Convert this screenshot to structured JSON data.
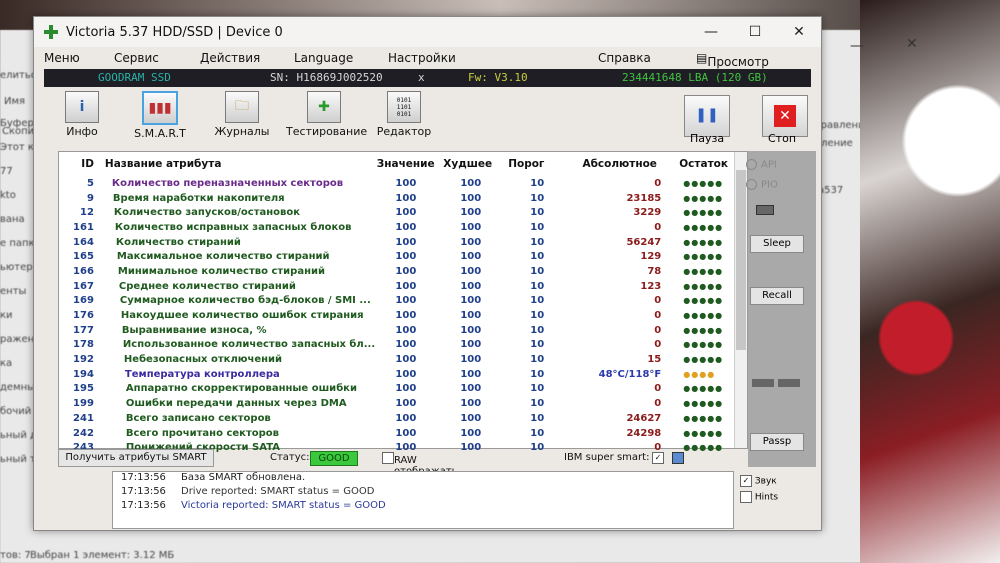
{
  "background_explorer": {
    "side_labels": [
      "елиться",
      "",
      "Буфер обм",
      "Этот компь",
      "77",
      "kto",
      "вана",
      "е папки",
      "ьютер",
      "енты",
      "ки",
      "ражения",
      "ка",
      "демные об",
      "бочий стол",
      "ьный дис",
      "ьный том (D:)"
    ],
    "header_col": "Имя",
    "right_labels": [
      "Управление",
      "деление",
      "а537"
    ],
    "status": "Выбран 1 элемент: 3.12 МБ",
    "left_status": "тов: 7",
    "top_left": "Скопировать В"
  },
  "window": {
    "title": "Victoria 5.37 HDD/SSD | Device 0",
    "menu": [
      "Меню",
      "Сервис",
      "Действия",
      "Language",
      "Настройки",
      "Справка",
      "Просмотр буфера"
    ],
    "info": {
      "model": "GOODRAM SSD",
      "serial": "SN: H16869J002520",
      "close": "x",
      "firmware": "Fw: V3.10",
      "lba": "234441648 LBA (120 GB)"
    },
    "toolbar": [
      {
        "label": "Инфо",
        "icon": "info-icon"
      },
      {
        "label": "S.M.A.R.T",
        "icon": "smart-chart-icon"
      },
      {
        "label": "Журналы",
        "icon": "journals-icon"
      },
      {
        "label": "Тестирование",
        "icon": "test-plus-icon"
      },
      {
        "label": "Редактор",
        "icon": "hex-editor-icon"
      }
    ],
    "pause_label": "Пауза",
    "stop_label": "Стоп",
    "table_headers": [
      "ID",
      "Название атрибута",
      "Значение",
      "Худшее",
      "Порог",
      "Абсолютное",
      "Остаток"
    ],
    "rows": [
      {
        "id": "5",
        "name": "Количество переназначенных секторов",
        "val": "100",
        "worst": "100",
        "thr": "10",
        "abs": "0",
        "dots": "●●●●●",
        "nc": "#6a2a8a"
      },
      {
        "id": "9",
        "name": "Время наработки накопителя",
        "val": "100",
        "worst": "100",
        "thr": "10",
        "abs": "23185",
        "dots": "●●●●●",
        "nc": "#1f5a1f"
      },
      {
        "id": "12",
        "name": "Количество запусков/остановок",
        "val": "100",
        "worst": "100",
        "thr": "10",
        "abs": "3229",
        "dots": "●●●●●",
        "nc": "#1f5a1f"
      },
      {
        "id": "161",
        "name": "Количество исправных запасных блоков",
        "val": "100",
        "worst": "100",
        "thr": "10",
        "abs": "0",
        "dots": "●●●●●",
        "nc": "#1f5a1f"
      },
      {
        "id": "164",
        "name": "Количество стираний",
        "val": "100",
        "worst": "100",
        "thr": "10",
        "abs": "56247",
        "dots": "●●●●●",
        "nc": "#1f5a1f"
      },
      {
        "id": "165",
        "name": "Максимальное количество стираний",
        "val": "100",
        "worst": "100",
        "thr": "10",
        "abs": "129",
        "dots": "●●●●●",
        "nc": "#1f5a1f"
      },
      {
        "id": "166",
        "name": "Минимальное количество стираний",
        "val": "100",
        "worst": "100",
        "thr": "10",
        "abs": "78",
        "dots": "●●●●●",
        "nc": "#1f5a1f"
      },
      {
        "id": "167",
        "name": "Среднее количество стираний",
        "val": "100",
        "worst": "100",
        "thr": "10",
        "abs": "123",
        "dots": "●●●●●",
        "nc": "#1f5a1f"
      },
      {
        "id": "169",
        "name": "Суммарное количество бэд-блоков / SMI ...",
        "val": "100",
        "worst": "100",
        "thr": "10",
        "abs": "0",
        "dots": "●●●●●",
        "nc": "#1f5a1f"
      },
      {
        "id": "176",
        "name": "Накоудшее количество ошибок стирания",
        "val": "100",
        "worst": "100",
        "thr": "10",
        "abs": "0",
        "dots": "●●●●●",
        "nc": "#1f5a1f"
      },
      {
        "id": "177",
        "name": "Выравнивание износа, %",
        "val": "100",
        "worst": "100",
        "thr": "10",
        "abs": "0",
        "dots": "●●●●●",
        "nc": "#1f5a1f"
      },
      {
        "id": "178",
        "name": "Использованное количество запасных бл...",
        "val": "100",
        "worst": "100",
        "thr": "10",
        "abs": "0",
        "dots": "●●●●●",
        "nc": "#1f5a1f"
      },
      {
        "id": "192",
        "name": "Небезопасных отключений",
        "val": "100",
        "worst": "100",
        "thr": "10",
        "abs": "15",
        "dots": "●●●●●",
        "nc": "#1f5a1f"
      },
      {
        "id": "194",
        "name": "Температура контроллера",
        "val": "100",
        "worst": "100",
        "thr": "10",
        "abs": "48°C/118°F",
        "dots": "●●●●",
        "nc": "#3a2aa0"
      },
      {
        "id": "195",
        "name": "Аппаратно скорректированные ошибки",
        "val": "100",
        "worst": "100",
        "thr": "10",
        "abs": "0",
        "dots": "●●●●●",
        "nc": "#1f5a1f"
      },
      {
        "id": "199",
        "name": "Ошибки передачи данных через DMA",
        "val": "100",
        "worst": "100",
        "thr": "10",
        "abs": "0",
        "dots": "●●●●●",
        "nc": "#1f5a1f"
      },
      {
        "id": "241",
        "name": "Всего записано секторов",
        "val": "100",
        "worst": "100",
        "thr": "10",
        "abs": "24627",
        "dots": "●●●●●",
        "nc": "#1f5a1f"
      },
      {
        "id": "242",
        "name": "Всего прочитано секторов",
        "val": "100",
        "worst": "100",
        "thr": "10",
        "abs": "24298",
        "dots": "●●●●●",
        "nc": "#1f5a1f"
      },
      {
        "id": "243",
        "name": "Понижений скорости SATA",
        "val": "100",
        "worst": "100",
        "thr": "10",
        "abs": "0",
        "dots": "●●●●●",
        "nc": "#1f5a1f"
      }
    ],
    "side": {
      "api": "API",
      "pio": "PIO",
      "sleep": "Sleep",
      "recall": "Recall",
      "passp": "Passp"
    },
    "bottom": {
      "get_attrs": "Получить атрибуты SMART",
      "status_label": "Статус:",
      "status_value": "GOOD",
      "raw": "RAW отображать в HEX",
      "ibm": "IBM super smart:"
    },
    "log": [
      {
        "time": "17:13:56",
        "msg": "База SMART обновлена.",
        "color": "#222"
      },
      {
        "time": "17:13:56",
        "msg": "Drive reported: SMART status = GOOD",
        "color": "#333"
      },
      {
        "time": "17:13:56",
        "msg": "Victoria reported: SMART status = GOOD",
        "color": "#2a3a9a"
      }
    ],
    "sound": "Звук",
    "hints": "Hints"
  }
}
